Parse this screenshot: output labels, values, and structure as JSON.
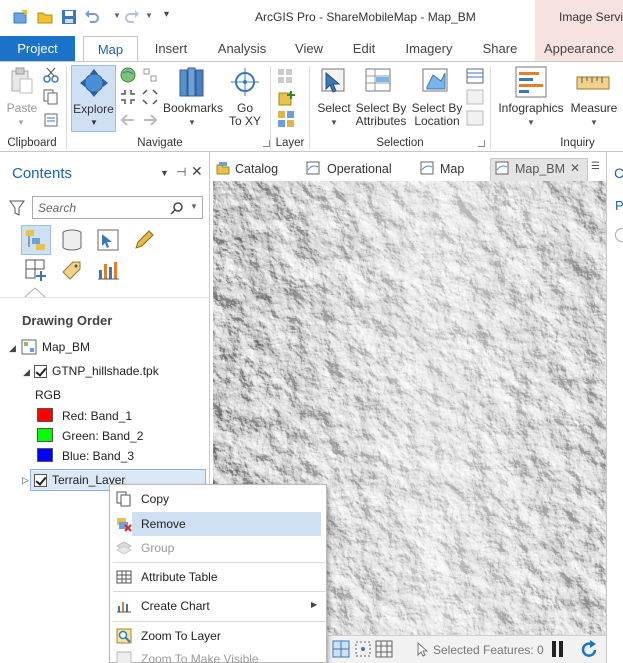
{
  "titlebar": {
    "title": "ArcGIS Pro - ShareMobileMap - Map_BM",
    "context_tab": "Image Servic"
  },
  "ribbon_tabs": [
    "Project",
    "Map",
    "Insert",
    "Analysis",
    "View",
    "Edit",
    "Imagery",
    "Share",
    "Appearance"
  ],
  "ribbon": {
    "clipboard": {
      "paste": "Paste",
      "group": "Clipboard"
    },
    "navigate": {
      "explore": "Explore",
      "bookmarks": "Bookmarks",
      "goto_line1": "Go",
      "goto_line2": "To XY",
      "group": "Navigate"
    },
    "layer": {
      "group": "Layer"
    },
    "selection": {
      "select": "Select",
      "by_attr_line1": "Select By",
      "by_attr_line2": "Attributes",
      "by_loc_line1": "Select By",
      "by_loc_line2": "Location",
      "group": "Selection"
    },
    "inquiry": {
      "infographics": "Infographics",
      "measure": "Measure",
      "group": "Inquiry"
    }
  },
  "contents": {
    "title": "Contents",
    "search_placeholder": "Search",
    "drawing_order": "Drawing Order",
    "map_name": "Map_BM",
    "layers": [
      {
        "name": "GTNP_hillshade.tpk",
        "checked": true
      },
      {
        "name": "Terrain_Layer",
        "checked": true
      }
    ],
    "rgb": "RGB",
    "bands": [
      {
        "label": "Red:  Band_1",
        "color": "#ff0000"
      },
      {
        "label": "Green: Band_2",
        "color": "#00ff00"
      },
      {
        "label": "Blue:  Band_3",
        "color": "#0000ff"
      }
    ]
  },
  "doc_tabs": [
    "Catalog",
    "Operational",
    "Map",
    "Map_BM"
  ],
  "context_menu": {
    "items": [
      {
        "label": "Copy",
        "disabled": false
      },
      {
        "label": "Remove",
        "disabled": false,
        "highlighted": true
      },
      {
        "label": "Group",
        "disabled": true
      },
      {
        "label": "Attribute Table",
        "disabled": false
      },
      {
        "label": "Create Chart",
        "disabled": false
      },
      {
        "label": "Zoom To Layer",
        "disabled": false
      },
      {
        "label": "Zoom To Make Visible",
        "disabled": true
      }
    ]
  },
  "status": {
    "selected_features": "Selected Features: 0"
  },
  "right_pane": {
    "letter1": "C",
    "letter2": "P"
  },
  "colors": {
    "accent": "#1a73c9",
    "highlight": "#cfe0f3",
    "context_tab": "#f6e3df"
  }
}
